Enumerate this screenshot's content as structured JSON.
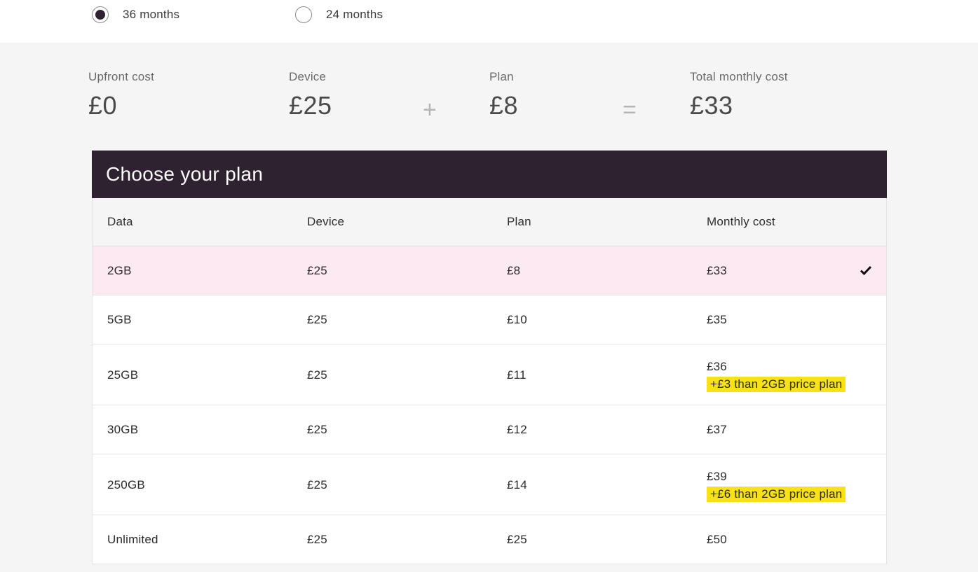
{
  "term_options": [
    {
      "label": "36 months",
      "selected": true
    },
    {
      "label": "24 months",
      "selected": false
    }
  ],
  "summary": {
    "upfront": {
      "label": "Upfront cost",
      "value": "£0"
    },
    "device": {
      "label": "Device",
      "value": "£25"
    },
    "plus": "+",
    "plan": {
      "label": "Plan",
      "value": "£8"
    },
    "equals": "=",
    "total": {
      "label": "Total monthly cost",
      "value": "£33"
    }
  },
  "plan_table": {
    "title": "Choose your plan",
    "columns": [
      "Data",
      "Device",
      "Plan",
      "Monthly cost"
    ],
    "rows": [
      {
        "data": "2GB",
        "device": "£25",
        "plan": "£8",
        "monthly": "£33",
        "note": "",
        "selected": true
      },
      {
        "data": "5GB",
        "device": "£25",
        "plan": "£10",
        "monthly": "£35",
        "note": "",
        "selected": false
      },
      {
        "data": "25GB",
        "device": "£25",
        "plan": "£11",
        "monthly": "£36",
        "note": "+£3 than 2GB price plan",
        "selected": false
      },
      {
        "data": "30GB",
        "device": "£25",
        "plan": "£12",
        "monthly": "£37",
        "note": "",
        "selected": false
      },
      {
        "data": "250GB",
        "device": "£25",
        "plan": "£14",
        "monthly": "£39",
        "note": "+£6 than 2GB price plan",
        "selected": false
      },
      {
        "data": "Unlimited",
        "device": "£25",
        "plan": "£25",
        "monthly": "£50",
        "note": "",
        "selected": false
      }
    ]
  },
  "colors": {
    "header_bg": "#2f2230",
    "selected_row_bg": "#fce9f1",
    "highlight": "#f8e216"
  },
  "icons": {
    "selected_row": "checkmark-icon"
  }
}
